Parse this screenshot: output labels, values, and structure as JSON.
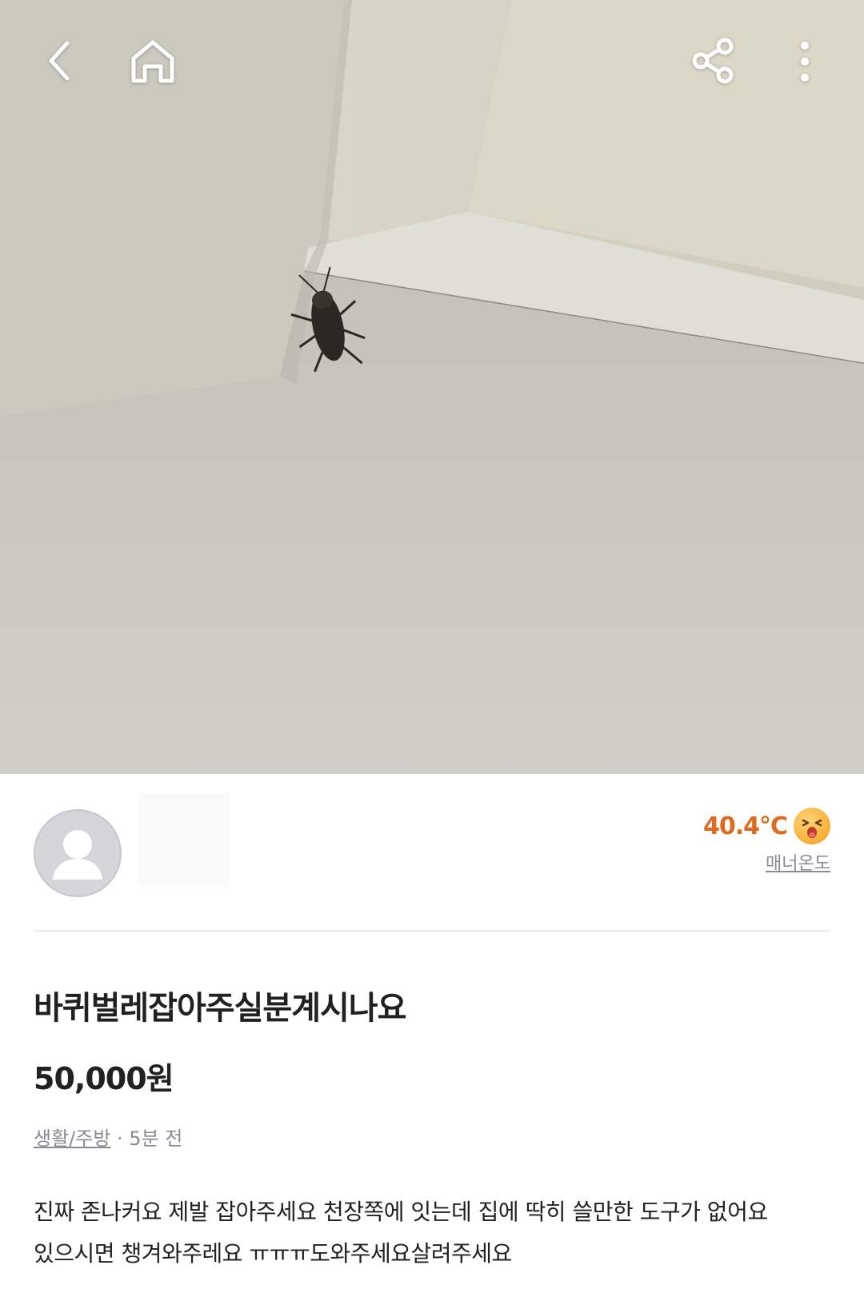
{
  "top_bar": {
    "back_icon": "chevron-left-icon",
    "home_icon": "home-icon",
    "share_icon": "share-icon",
    "more_icon": "more-vertical-icon"
  },
  "photo": {
    "subject": "cockroach on ceiling corner",
    "icon": "photo-cockroach"
  },
  "profile": {
    "avatar_icon": "default-avatar-icon",
    "temperature": "40.4°C",
    "temperature_color": "#de6a1f",
    "emoji_icon": "hot-face-emoji-icon",
    "manner_label": "매너온도"
  },
  "post": {
    "title": "바퀴벌레잡아주실분계시나요",
    "price": "50,000원",
    "category": "생활/주방",
    "separator": " · ",
    "time_ago": "5분 전",
    "body_line1": "진짜 존나커요 제발 잡아주세요 천장쪽에 잇는데 집에 딱히 쓸만한 도구가 없어요",
    "body_line2": "있으시면 챙겨와주레요 ㅠㅠㅠ도와주세요살려주세요"
  }
}
